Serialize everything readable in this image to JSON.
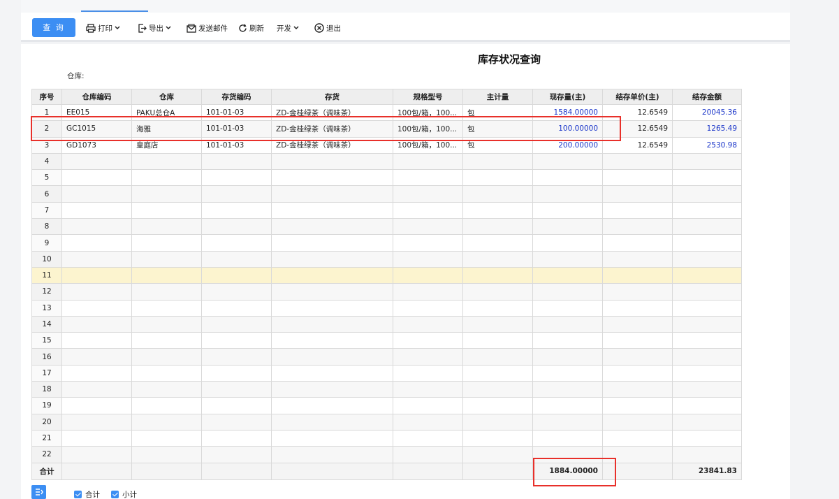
{
  "toolbar": {
    "query_label": "查 询",
    "print_label": "打印",
    "export_label": "导出",
    "email_label": "发送邮件",
    "refresh_label": "刷新",
    "develop_label": "开发",
    "exit_label": "退出"
  },
  "report": {
    "title": "库存状况查询",
    "warehouse_label": "仓库:"
  },
  "table": {
    "columns": [
      "序号",
      "仓库编码",
      "仓库",
      "存货编码",
      "存货",
      "规格型号",
      "主计量",
      "现存量(主)",
      "结存单价(主)",
      "结存金额"
    ],
    "rows": [
      {
        "idx": "1",
        "wh_code": "EE015",
        "wh": "PAKU总仓A",
        "inv_code": "101-01-03",
        "inv": "ZD-金桂绿茶（调味茶）",
        "spec": "100包/箱，100...",
        "unit": "包",
        "qty": "1584.00000",
        "price": "12.6549",
        "amount": "20045.36"
      },
      {
        "idx": "2",
        "wh_code": "GC1015",
        "wh": "海雅",
        "inv_code": "101-01-03",
        "inv": "ZD-金桂绿茶（调味茶）",
        "spec": "100包/箱，100...",
        "unit": "包",
        "qty": "100.00000",
        "price": "12.6549",
        "amount": "1265.49"
      },
      {
        "idx": "3",
        "wh_code": "GD1073",
        "wh": "皇庭店",
        "inv_code": "101-01-03",
        "inv": "ZD-金桂绿茶（调味茶）",
        "spec": "100包/箱，100...",
        "unit": "包",
        "qty": "200.00000",
        "price": "12.6549",
        "amount": "2530.98"
      },
      {
        "idx": "4"
      },
      {
        "idx": "5"
      },
      {
        "idx": "6"
      },
      {
        "idx": "7"
      },
      {
        "idx": "8"
      },
      {
        "idx": "9"
      },
      {
        "idx": "10"
      },
      {
        "idx": "11"
      },
      {
        "idx": "12"
      },
      {
        "idx": "13"
      },
      {
        "idx": "14"
      },
      {
        "idx": "15"
      },
      {
        "idx": "16"
      },
      {
        "idx": "17"
      },
      {
        "idx": "18"
      },
      {
        "idx": "19"
      },
      {
        "idx": "20"
      },
      {
        "idx": "21"
      },
      {
        "idx": "22"
      }
    ],
    "highlight_row": "11",
    "total": {
      "label": "合计",
      "qty": "1884.00000",
      "amount": "23841.83"
    }
  },
  "footer": {
    "total_checkbox_label": "合计",
    "subtotal_checkbox_label": "小计"
  },
  "colors": {
    "primary": "#3c8ef3",
    "link_blue": "#1a35c9",
    "highlight": "#fcf4cf",
    "annotation_red": "#e8302a"
  }
}
